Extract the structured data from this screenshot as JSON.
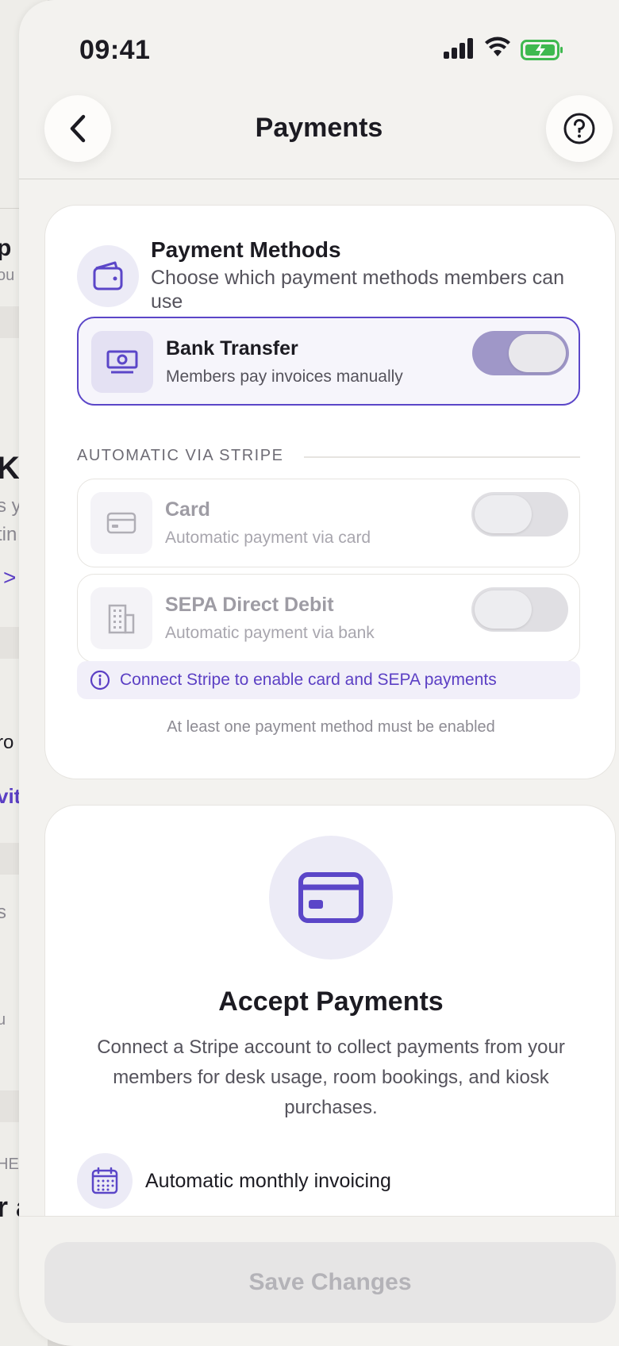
{
  "status_bar": {
    "time": "09:41"
  },
  "nav": {
    "title": "Payments"
  },
  "payment_methods": {
    "title": "Payment Methods",
    "subtitle": "Choose which payment methods members can use",
    "bank_transfer": {
      "name": "Bank Transfer",
      "desc": "Members pay invoices manually",
      "enabled": true
    },
    "section_label": "AUTOMATIC VIA STRIPE",
    "card": {
      "name": "Card",
      "desc": "Automatic payment via card",
      "enabled": false
    },
    "sepa": {
      "name": "SEPA Direct Debit",
      "desc": "Automatic payment via bank",
      "enabled": false
    },
    "notice": "Connect Stripe to enable card and SEPA payments",
    "footnote": "At least one payment method must be enabled"
  },
  "accept_payments": {
    "title": "Accept Payments",
    "desc": "Connect a Stripe account to collect payments from your members for desk usage, room bookings, and kiosk purchases.",
    "features": [
      "Automatic monthly invoicing"
    ]
  },
  "footer": {
    "save_label": "Save Changes"
  },
  "colors": {
    "accent": "#5b46c8",
    "accent_light": "#ecebf6",
    "background": "#f3f2ef"
  },
  "background_fragments": [
    "p",
    "ou",
    "Ki",
    "s y",
    "tin",
    ">",
    "ro",
    "vit",
    "s",
    "u",
    "HEA",
    "r a"
  ]
}
